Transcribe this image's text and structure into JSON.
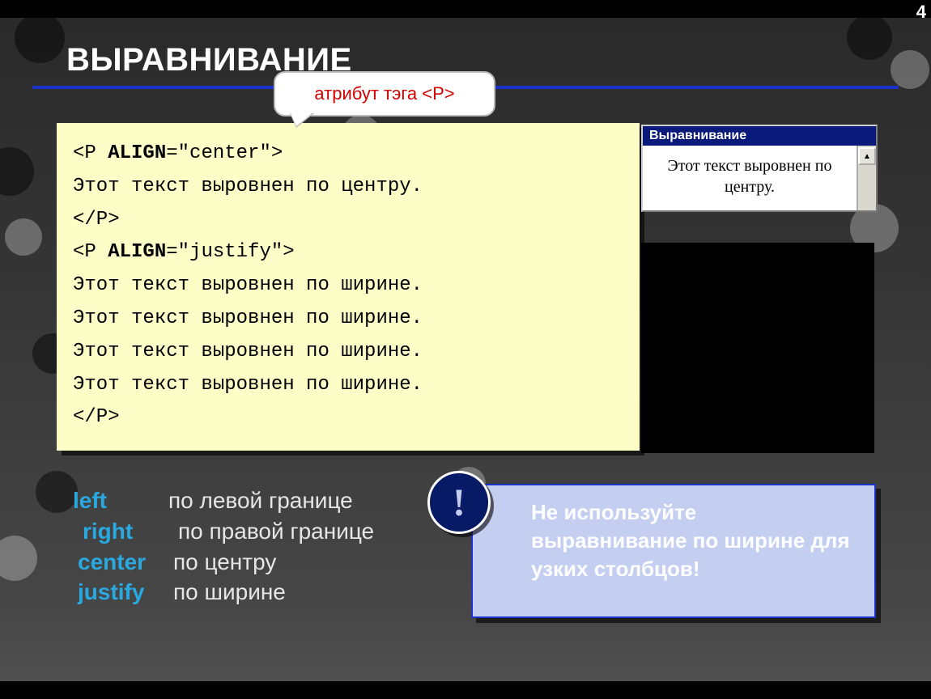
{
  "page_number": "4",
  "title": "ВЫРАВНИВАНИЕ",
  "callout": {
    "prefix": "атрибут тэга ",
    "tag": "<P>"
  },
  "code": {
    "l1_open": "<P ",
    "l1_attr": "ALIGN",
    "l1_rest": "=\"center\">",
    "l2": "Этот текст выровнен по центру.",
    "l3": "</P>",
    "l4_open": "<P ",
    "l4_attr": "ALIGN",
    "l4_rest": "=\"justify\">",
    "l5": "Этот текст выровнен по ширине.",
    "l6": "Этот текст выровнен по ширине.",
    "l7": "Этот текст выровнен по ширине.",
    "l8": "Этот текст выровнен по ширине.",
    "l9": "</P>"
  },
  "preview": {
    "title": "Выравнивание",
    "text": "Этот текст выровнен по центру.",
    "scroll_up": "▲"
  },
  "align_list": {
    "r1k": "left",
    "r1v": "по левой границе",
    "r2k": "right",
    "r2v": "по правой границе",
    "r3k": "center",
    "r3v": "по центру",
    "r4k": "justify",
    "r4v": "по ширине"
  },
  "note": {
    "badge": "!",
    "text": "Не используйте выравнивание по ширине для узких столбцов!"
  }
}
